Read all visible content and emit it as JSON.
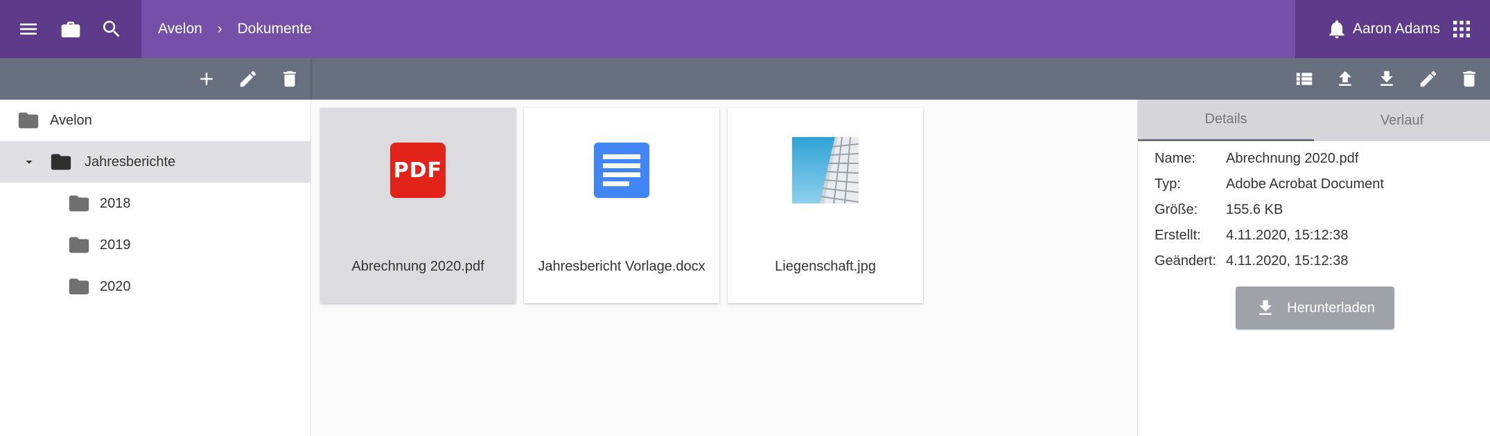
{
  "header": {
    "breadcrumbs": [
      "Avelon",
      "Dokumente"
    ],
    "breadcrumb_separator": "›",
    "user_name": "Aaron Adams",
    "icons": [
      "menu-icon",
      "briefcase-icon",
      "search-icon",
      "bell-icon",
      "apps-grid-icon"
    ],
    "color": "#7450a9",
    "dark_color": "#5d3a8a"
  },
  "toolbar": {
    "left_icons": [
      "add-icon",
      "edit-icon",
      "delete-icon"
    ],
    "right_icons": [
      "list-view-icon",
      "upload-icon",
      "download-icon",
      "edit-icon",
      "delete-icon"
    ],
    "color": "#687080"
  },
  "tree": {
    "root": "Avelon",
    "items": [
      {
        "label": "Jahresberichte",
        "expanded": true,
        "selected": true
      },
      {
        "label": "2018"
      },
      {
        "label": "2019"
      },
      {
        "label": "2020"
      }
    ]
  },
  "files": [
    {
      "name": "Abrechnung 2020.pdf",
      "type": "pdf",
      "badge": "PDF",
      "selected": true
    },
    {
      "name": "Jahresbericht Vorlage.docx",
      "type": "doc"
    },
    {
      "name": "Liegenschaft.jpg",
      "type": "image"
    }
  ],
  "details": {
    "tabs": [
      "Details",
      "Verlauf"
    ],
    "active_tab": "Details",
    "fields": [
      {
        "key": "Name:",
        "value": "Abrechnung 2020.pdf"
      },
      {
        "key": "Typ:",
        "value": "Adobe Acrobat Document"
      },
      {
        "key": "Größe:",
        "value": "155.6 KB"
      },
      {
        "key": "Erstellt:",
        "value": "4.11.2020, 15:12:38"
      },
      {
        "key": "Geändert:",
        "value": "4.11.2020, 15:12:38"
      }
    ],
    "download_label": "Herunterladen"
  }
}
